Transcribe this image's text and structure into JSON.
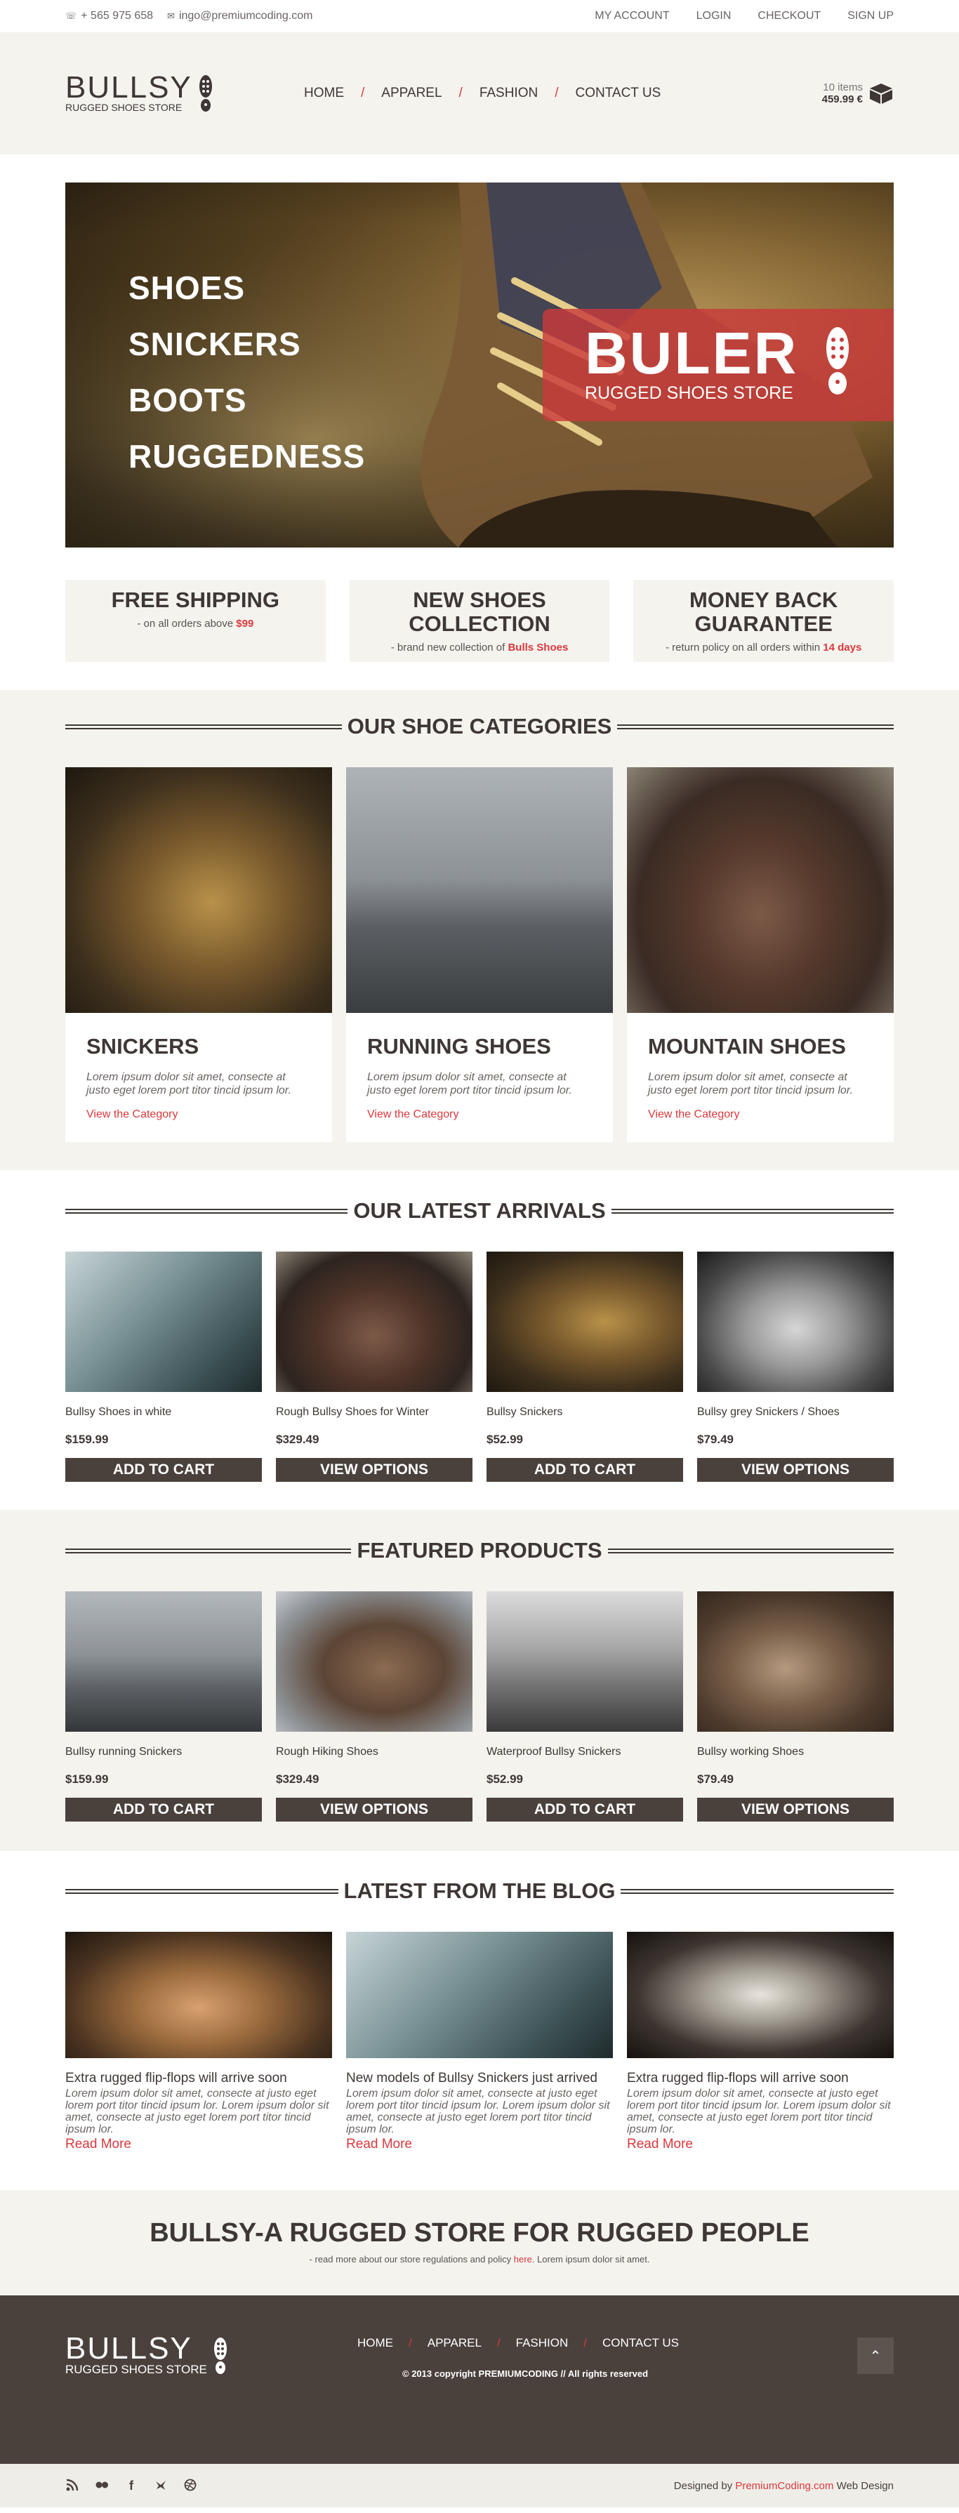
{
  "topbar": {
    "phone": "+ 565 975 658",
    "email": "ingo@premiumcoding.com",
    "links": [
      "MY ACCOUNT",
      "LOGIN",
      "CHECKOUT",
      "SIGN UP"
    ]
  },
  "header": {
    "logo_name": "BULLSY",
    "logo_tag": "RUGGED SHOES STORE",
    "nav": [
      "HOME",
      "APPAREL",
      "FASHION",
      "CONTACT US"
    ],
    "cart_items": "10 items",
    "cart_total": "459.99 €"
  },
  "hero": {
    "words": [
      "SHOES",
      "SNICKERS",
      "BOOTS",
      "RUGGEDNESS"
    ],
    "badge_big": "BULER",
    "badge_small": "RUGGED SHOES STORE"
  },
  "features": [
    {
      "title": "FREE SHIPPING",
      "text": "- on all orders above",
      "highlight": "$99"
    },
    {
      "title": "NEW SHOES COLLECTION",
      "text": "- brand new collection of",
      "highlight": "Bulls Shoes"
    },
    {
      "title": "MONEY BACK GUARANTEE",
      "text": "- return policy on all orders within",
      "highlight": "14 days"
    }
  ],
  "categories": {
    "heading": "OUR SHOE CATEGORIES",
    "items": [
      {
        "title": "SNICKERS",
        "text": "Lorem ipsum dolor sit amet, consecte at justo eget lorem port titor tincid ipsum lor.",
        "link": "View the Category"
      },
      {
        "title": "RUNNING SHOES",
        "text": "Lorem ipsum dolor sit amet, consecte at justo eget lorem port titor tincid ipsum lor.",
        "link": "View the Category"
      },
      {
        "title": "MOUNTAIN SHOES",
        "text": "Lorem ipsum dolor sit amet, consecte at justo eget lorem port titor tincid ipsum lor.",
        "link": "View the Category"
      }
    ]
  },
  "latest": {
    "heading": "OUR LATEST ARRIVALS",
    "items": [
      {
        "name": "Bullsy Shoes in white",
        "price": "$159.99",
        "button": "ADD TO CART"
      },
      {
        "name": "Rough Bullsy Shoes for Winter",
        "price": "$329.49",
        "button": "VIEW OPTIONS"
      },
      {
        "name": "Bullsy Snickers",
        "price": "$52.99",
        "button": "ADD TO CART"
      },
      {
        "name": "Bullsy grey Snickers / Shoes",
        "price": "$79.49",
        "button": "VIEW OPTIONS"
      }
    ]
  },
  "featured": {
    "heading": "FEATURED PRODUCTS",
    "items": [
      {
        "name": "Bullsy running Snickers",
        "price": "$159.99",
        "button": "ADD TO CART"
      },
      {
        "name": "Rough Hiking Shoes",
        "price": "$329.49",
        "button": "VIEW OPTIONS"
      },
      {
        "name": "Waterproof Bullsy Snickers",
        "price": "$52.99",
        "button": "ADD TO CART"
      },
      {
        "name": "Bullsy working Shoes",
        "price": "$79.49",
        "button": "VIEW OPTIONS"
      }
    ]
  },
  "blog": {
    "heading": "LATEST FROM THE BLOG",
    "posts": [
      {
        "title": "Extra rugged flip-flops will arrive soon",
        "text": "Lorem ipsum dolor sit amet, consecte at justo eget lorem port titor tincid ipsum lor. Lorem ipsum dolor sit amet, consecte at justo eget lorem port titor tincid ipsum lor.",
        "link": "Read More"
      },
      {
        "title": "New models of Bullsy Snickers just arrived",
        "text": "Lorem ipsum dolor sit amet, consecte at justo eget lorem port titor tincid ipsum lor. Lorem ipsum dolor sit amet, consecte at justo eget lorem port titor tincid ipsum lor.",
        "link": "Read More"
      },
      {
        "title": "Extra rugged flip-flops will arrive soon",
        "text": "Lorem ipsum dolor sit amet, consecte at justo eget lorem port titor tincid ipsum lor. Lorem ipsum dolor sit amet, consecte at justo eget lorem port titor tincid ipsum lor.",
        "link": "Read More"
      }
    ]
  },
  "about": {
    "title": "BULLSY-A RUGGED STORE FOR RUGGED PEOPLE",
    "text_before": "- read more about our store regulations and policy",
    "link": "here",
    "text_after": ". Lorem ipsum dolor sit amet."
  },
  "footer": {
    "logo_name": "BULLSY",
    "logo_tag": "RUGGED SHOES STORE",
    "nav": [
      "HOME",
      "APPAREL",
      "FASHION",
      "CONTACT US"
    ],
    "copyright": "© 2013 copyright PREMIUMCODING // All rights reserved",
    "social_icons": [
      "rss-icon",
      "flickr-icon",
      "facebook-icon",
      "twitter-icon",
      "dribbble-icon"
    ],
    "credit_before": "Designed by",
    "credit_link": "PremiumCoding.com",
    "credit_after": "Web Design"
  },
  "colors": {
    "accent": "#d9393d",
    "dark": "#4a413d",
    "light_bg": "#f4f3ee"
  }
}
